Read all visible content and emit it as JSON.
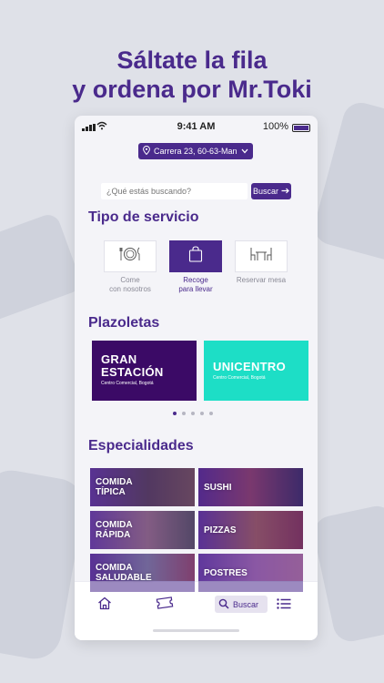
{
  "headline": {
    "line1": "Sáltate la fila",
    "line2": "y ordena por Mr.Toki"
  },
  "status_bar": {
    "time": "9:41 AM",
    "battery": "100%"
  },
  "location": {
    "text": "Carrera 23, 60-63-Man..."
  },
  "search": {
    "placeholder": "¿Qué estás buscando?",
    "button_label": "Buscar"
  },
  "service_section": {
    "title": "Tipo de servicio",
    "options": [
      {
        "line1": "Come",
        "line2": "con nosotros",
        "icon": "plate-cutlery-icon",
        "active": false
      },
      {
        "line1": "Recoge",
        "line2": "para llevar",
        "icon": "shopping-bag-icon",
        "active": true
      },
      {
        "line1": "Reservar mesa",
        "line2": "",
        "icon": "table-chairs-icon",
        "active": false
      }
    ]
  },
  "plazas_section": {
    "title": "Plazoletas",
    "items": [
      {
        "line1": "GRAN",
        "line2": "ESTACIÓN",
        "subtitle": "Centro Comercial, Bogotá",
        "color": "#3b0a66"
      },
      {
        "line1": "UNICENTRO",
        "line2": "",
        "subtitle": "Centro Comercial, Bogotá",
        "color": "#1ddec6"
      }
    ],
    "pagination": {
      "count": 5,
      "active": 1
    }
  },
  "specialties_section": {
    "title": "Especialidades",
    "items": [
      {
        "line1": "COMIDA",
        "line2": "TÍPICA"
      },
      {
        "line1": "SUSHI",
        "line2": ""
      },
      {
        "line1": "COMIDA",
        "line2": "RÁPIDA"
      },
      {
        "line1": "PIZZAS",
        "line2": ""
      },
      {
        "line1": "COMIDA",
        "line2": "SALUDABLE"
      },
      {
        "line1": "POSTRES",
        "line2": ""
      }
    ]
  },
  "bottom_nav": {
    "search_label": "Buscar",
    "icons": [
      "home-icon",
      "ticket-icon",
      "search-icon",
      "list-menu-icon"
    ]
  },
  "colors": {
    "brand_purple": "#4a2a8c",
    "gran_estacion": "#3b0a66",
    "unicentro": "#1ddec6",
    "background": "#dfe1e8"
  }
}
